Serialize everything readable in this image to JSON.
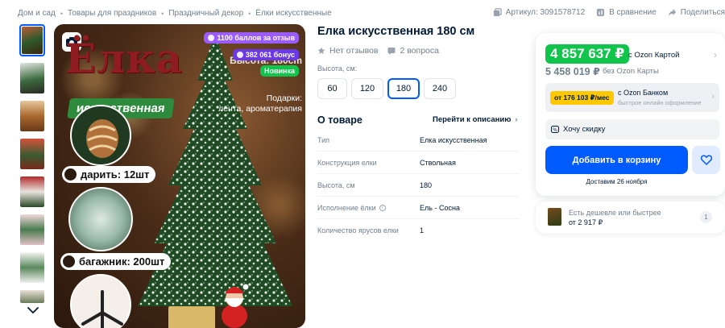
{
  "breadcrumb": [
    "Дом и сад",
    "Товары для праздников",
    "Праздничный декор",
    "Ёлки искусственные"
  ],
  "top_actions": {
    "article": "Артикул: 3091578712",
    "compare": "В сравнение",
    "share": "Поделиться"
  },
  "gallery": {
    "thumbnail_count": 8,
    "image_text": {
      "title": "Ёлка",
      "subtitle": "искусственная",
      "height": "Высота: 180cm",
      "gifts": "Подарки:\nлента, ароматерапия",
      "gift_label": "дарить: 12шт",
      "trunk_label": "багажник: 200шт"
    },
    "badges": {
      "points": "1100 баллов за отзыв",
      "bonus": "382 061 бонус",
      "new": "Новинка"
    }
  },
  "product": {
    "title": "Елка искусственная 180 см",
    "reviews": "Нет отзывов",
    "questions": "2 вопроса",
    "height_label": "Высота, см:",
    "sizes": [
      "60",
      "120",
      "180",
      "240"
    ],
    "selected_size": "180"
  },
  "about": {
    "title": "О товаре",
    "to_description": "Перейти к описанию",
    "specs": [
      {
        "key": "Тип",
        "value": "Елка искусственная",
        "info": false
      },
      {
        "key": "Конструкция елки",
        "value": "Ствольная",
        "info": false
      },
      {
        "key": "Высота, см",
        "value": "180",
        "info": false
      },
      {
        "key": "Исполнение ёлки",
        "value": "Ель - Сосна",
        "info": true
      },
      {
        "key": "Количество ярусов елки",
        "value": "1",
        "info": false
      }
    ]
  },
  "price_card": {
    "card_price": "4 857 637 ₽",
    "card_price_label": "с Ozon Картой",
    "regular_price": "5 458 019 ₽",
    "regular_price_label": "без Ozon Карты",
    "installment_badge": "от 176 103 ₽/мес",
    "installment_title": "с Ozon Банком",
    "installment_sub": "быстрое онлайн оформление",
    "discount": "Хочу скидку",
    "add_to_cart": "Добавить в корзину",
    "delivery": "Доставим 26 ноября"
  },
  "alternatives": {
    "title": "Есть дешевле или быстрее",
    "price": "от 2 917 ₽",
    "count": "1"
  },
  "colors": {
    "accent": "#005bff",
    "green_price": "#10c44c",
    "installment": "#ffc800",
    "text_secondary": "#707f8d"
  }
}
